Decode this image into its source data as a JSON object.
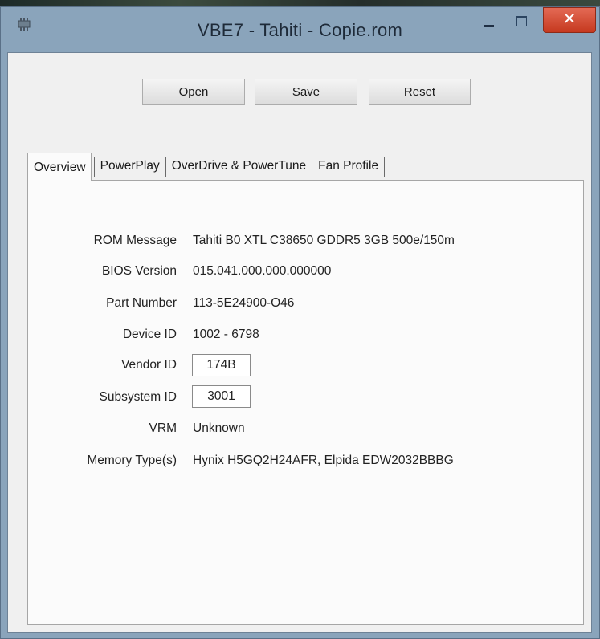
{
  "window": {
    "title": "VBE7 - Tahiti - Copie.rom",
    "close_symbol": "✕",
    "icons": {
      "app": "chip-icon",
      "minimize": "minimize-icon",
      "maximize": "maximize-icon",
      "close": "close-icon"
    },
    "colors": {
      "title_bar": "#8aa4bb",
      "close_button": "#c6391f",
      "client_background": "#f0f0f0"
    }
  },
  "toolbar": {
    "open_label": "Open",
    "save_label": "Save",
    "reset_label": "Reset"
  },
  "tabs": [
    {
      "label": "Overview",
      "active": true
    },
    {
      "label": "PowerPlay",
      "active": false
    },
    {
      "label": "OverDrive & PowerTune",
      "active": false
    },
    {
      "label": "Fan Profile",
      "active": false
    }
  ],
  "overview": {
    "rom_message": {
      "label": "ROM Message",
      "value": "Tahiti B0 XTL C38650 GDDR5 3GB 500e/150m"
    },
    "bios_version": {
      "label": "BIOS Version",
      "value": "015.041.000.000.000000"
    },
    "part_number": {
      "label": "Part Number",
      "value": "113-5E24900-O46"
    },
    "device_id": {
      "label": "Device ID",
      "value": "1002 - 6798"
    },
    "vendor_id": {
      "label": "Vendor ID",
      "value": "174B"
    },
    "subsystem_id": {
      "label": "Subsystem ID",
      "value": "3001"
    },
    "vrm": {
      "label": "VRM",
      "value": "Unknown"
    },
    "memory_types": {
      "label": "Memory Type(s)",
      "value": "Hynix H5GQ2H24AFR, Elpida EDW2032BBBG"
    }
  }
}
